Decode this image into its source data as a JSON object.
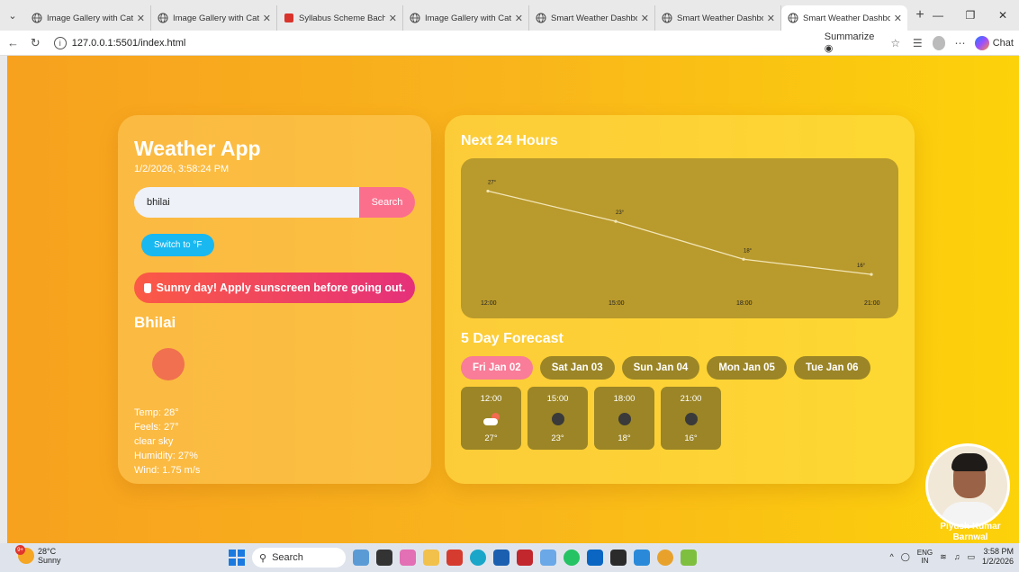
{
  "browser": {
    "tabs": [
      {
        "title": "Image Gallery with Cate",
        "icon": "globe-icon",
        "active": false
      },
      {
        "title": "Image Gallery with Cate",
        "icon": "globe-icon",
        "active": false
      },
      {
        "title": "Syllabus Scheme Bachel",
        "icon": "pdf-icon",
        "active": false
      },
      {
        "title": "Image Gallery with Cate",
        "icon": "globe-icon",
        "active": false
      },
      {
        "title": "Smart Weather Dashbo",
        "icon": "globe-icon",
        "active": false
      },
      {
        "title": "Smart Weather Dashbo",
        "icon": "globe-icon",
        "active": false
      },
      {
        "title": "Smart Weather Dashbo",
        "icon": "globe-icon",
        "active": true
      }
    ],
    "url": "127.0.0.1:5501/index.html",
    "summarize_label": "Summarize",
    "chat_label": "Chat"
  },
  "app": {
    "title": "Weather App",
    "datetime": "1/2/2026, 3:58:24 PM",
    "search": {
      "value": "bhilai",
      "button": "Search"
    },
    "unit_toggle": "Switch to °F",
    "alert": "Sunny day! Apply sunscreen before going out.",
    "city": "Bhilai",
    "stats": {
      "temp": "Temp: 28°",
      "feels": "Feels: 27°",
      "description": "clear sky",
      "humidity": "Humidity: 27%",
      "wind": "Wind: 1.75 m/s"
    },
    "hourly_title": "Next 24 Hours",
    "forecast_title": "5 Day Forecast",
    "days": [
      {
        "label": "Fri Jan 02",
        "active": true
      },
      {
        "label": "Sat Jan 03",
        "active": false
      },
      {
        "label": "Sun Jan 04",
        "active": false
      },
      {
        "label": "Mon Jan 05",
        "active": false
      },
      {
        "label": "Tue Jan 06",
        "active": false
      }
    ],
    "hours": [
      {
        "time": "12:00",
        "temp": "27°",
        "icon": "cloud-sun-icon"
      },
      {
        "time": "15:00",
        "temp": "23°",
        "icon": "night-dot-icon"
      },
      {
        "time": "18:00",
        "temp": "18°",
        "icon": "night-dot-icon"
      },
      {
        "time": "21:00",
        "temp": "16°",
        "icon": "night-dot-icon"
      }
    ],
    "profile_name": "Piyush Kumar Barnwal"
  },
  "chart_data": {
    "type": "line",
    "x": [
      "12:00",
      "15:00",
      "18:00",
      "21:00"
    ],
    "series": [
      {
        "values": [
          27,
          23,
          18,
          16
        ]
      }
    ],
    "point_labels": [
      "27°",
      "23°",
      "18°",
      "16°"
    ],
    "grid": false
  },
  "taskbar": {
    "weather_temp": "28°C",
    "weather_desc": "Sunny",
    "weather_badge": "9+",
    "search_label": "Search",
    "lang_top": "ENG",
    "lang_bottom": "IN",
    "time": "3:58 PM",
    "date": "1/2/2026"
  },
  "colors": {
    "accent_pink": "#f97c98",
    "accent_blue": "#19b8f0",
    "chart_line": "#f2e6b8"
  }
}
